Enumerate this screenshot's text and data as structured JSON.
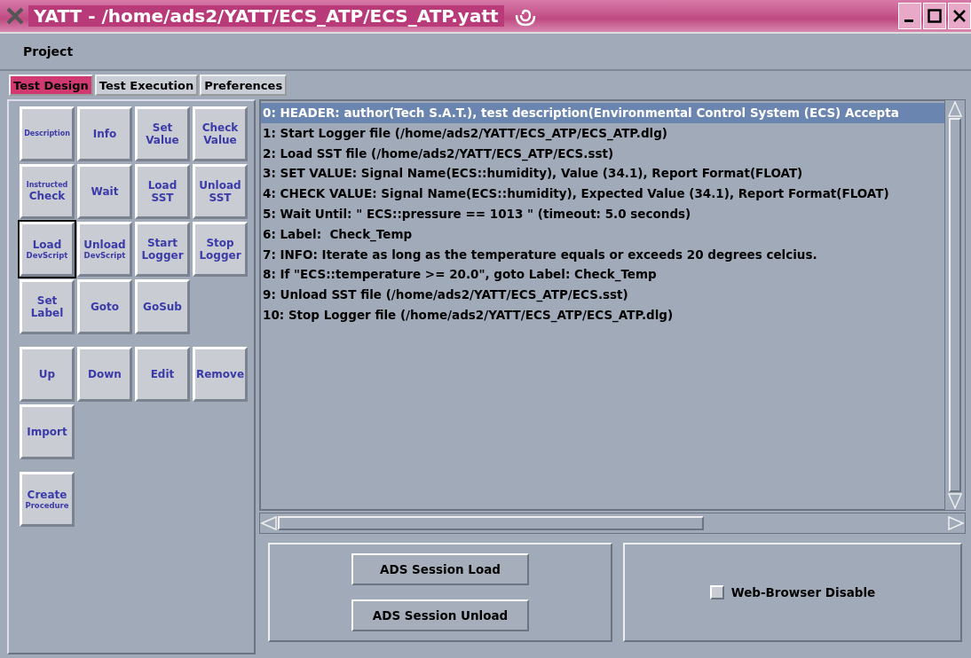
{
  "window": {
    "title": "YATT - /home/ads2/YATT/ECS_ATP/ECS_ATP.yatt"
  },
  "menu": [
    "Project"
  ],
  "tabs": [
    {
      "label": "Test Design",
      "selected": true
    },
    {
      "label": "Test Execution",
      "selected": false
    },
    {
      "label": "Preferences",
      "selected": false
    }
  ],
  "button_groups": [
    [
      {
        "lines": [
          {
            "text": "Description",
            "kind": "tiny"
          }
        ],
        "focused": false
      },
      {
        "lines": [
          {
            "text": "Info",
            "kind": "large"
          }
        ],
        "focused": false
      },
      {
        "lines": [
          {
            "text": "Set",
            "kind": "large"
          },
          {
            "text": "Value",
            "kind": "large"
          }
        ],
        "focused": false
      },
      {
        "lines": [
          {
            "text": "Check",
            "kind": "large"
          },
          {
            "text": "Value",
            "kind": "large"
          }
        ],
        "focused": false
      },
      {
        "lines": [
          {
            "text": "Instructed",
            "kind": "tiny"
          },
          {
            "text": "Check",
            "kind": "large"
          }
        ],
        "focused": false
      },
      {
        "lines": [
          {
            "text": "Wait",
            "kind": "large"
          }
        ],
        "focused": false
      },
      {
        "lines": [
          {
            "text": "Load",
            "kind": "large"
          },
          {
            "text": "SST",
            "kind": "large"
          }
        ],
        "focused": false
      },
      {
        "lines": [
          {
            "text": "Unload",
            "kind": "large"
          },
          {
            "text": "SST",
            "kind": "large"
          }
        ],
        "focused": false
      },
      {
        "lines": [
          {
            "text": "Load",
            "kind": "large"
          },
          {
            "text": "DevScript",
            "kind": "small"
          }
        ],
        "focused": true
      },
      {
        "lines": [
          {
            "text": "Unload",
            "kind": "large"
          },
          {
            "text": "DevScript",
            "kind": "small"
          }
        ],
        "focused": false
      },
      {
        "lines": [
          {
            "text": "Start",
            "kind": "large"
          },
          {
            "text": "Logger",
            "kind": "large"
          }
        ],
        "focused": false
      },
      {
        "lines": [
          {
            "text": "Stop",
            "kind": "large"
          },
          {
            "text": "Logger",
            "kind": "large"
          }
        ],
        "focused": false
      },
      {
        "lines": [
          {
            "text": "Set",
            "kind": "large"
          },
          {
            "text": "Label",
            "kind": "large"
          }
        ],
        "focused": false
      },
      {
        "lines": [
          {
            "text": "Goto",
            "kind": "large"
          }
        ],
        "focused": false
      },
      {
        "lines": [
          {
            "text": "GoSub",
            "kind": "large"
          }
        ],
        "focused": false
      }
    ],
    [
      {
        "lines": [
          {
            "text": "Up",
            "kind": "large"
          }
        ],
        "focused": false
      },
      {
        "lines": [
          {
            "text": "Down",
            "kind": "large"
          }
        ],
        "focused": false
      },
      {
        "lines": [
          {
            "text": "Edit",
            "kind": "large"
          }
        ],
        "focused": false
      },
      {
        "lines": [
          {
            "text": "Remove",
            "kind": "large"
          }
        ],
        "focused": false
      },
      {
        "lines": [
          {
            "text": "Import",
            "kind": "large"
          }
        ],
        "focused": false
      }
    ],
    [
      {
        "lines": [
          {
            "text": "Create",
            "kind": "large"
          },
          {
            "text": "Procedure",
            "kind": "small"
          }
        ],
        "focused": false
      }
    ]
  ],
  "steps": [
    {
      "text": "0: HEADER: author(Tech S.A.T.), test description(Environmental Control System (ECS) Accepta",
      "selected": true
    },
    {
      "text": "1: Start Logger file (/home/ads2/YATT/ECS_ATP/ECS_ATP.dlg)",
      "selected": false
    },
    {
      "text": "2: Load SST file (/home/ads2/YATT/ECS_ATP/ECS.sst)",
      "selected": false
    },
    {
      "text": "3: SET VALUE: Signal Name(ECS::humidity), Value (34.1), Report Format(FLOAT)",
      "selected": false
    },
    {
      "text": "4: CHECK VALUE: Signal Name(ECS::humidity), Expected Value (34.1), Report Format(FLOAT)",
      "selected": false
    },
    {
      "text": "5: Wait Until: \" ECS::pressure == 1013 \" (timeout: 5.0 seconds)",
      "selected": false
    },
    {
      "text": "6: Label:  Check_Temp",
      "selected": false
    },
    {
      "text": "7: INFO: Iterate as long as the temperature equals or exceeds 20 degrees celcius.",
      "selected": false
    },
    {
      "text": "8: If \"ECS::temperature >= 20.0\", goto Label: Check_Temp",
      "selected": false
    },
    {
      "text": "9: Unload SST file (/home/ads2/YATT/ECS_ATP/ECS.sst)",
      "selected": false
    },
    {
      "text": "10: Stop Logger file (/home/ads2/YATT/ECS_ATP/ECS_ATP.dlg)",
      "selected": false
    }
  ],
  "session_buttons": [
    "ADS Session Load",
    "ADS Session Unload"
  ],
  "web_browser_disable": {
    "label": "Web-Browser Disable",
    "checked": false
  }
}
